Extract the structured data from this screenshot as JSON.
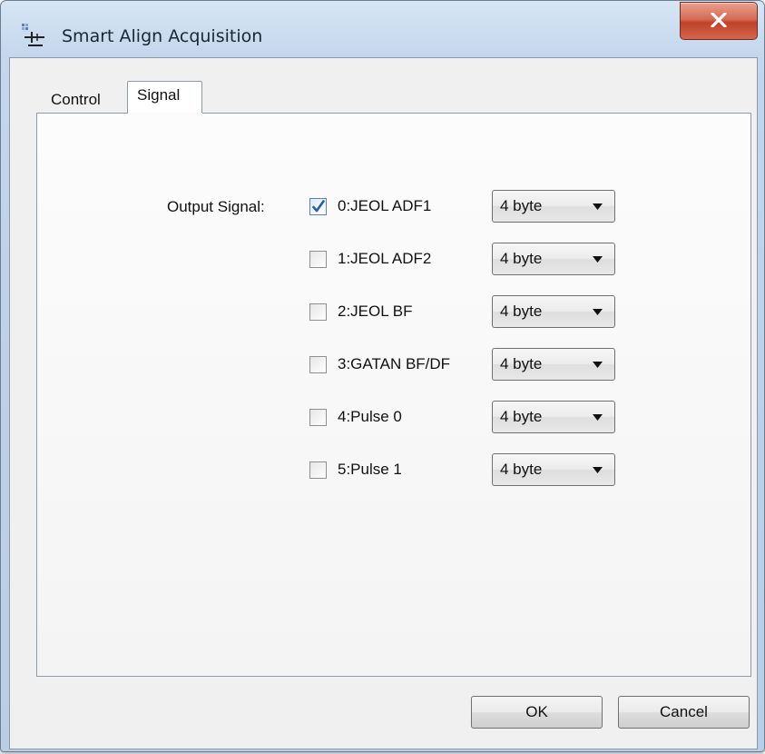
{
  "window": {
    "title": "Smart Align Acquisition"
  },
  "tabs": [
    {
      "label": "Control",
      "active": false
    },
    {
      "label": "Signal",
      "active": true
    }
  ],
  "signal_panel": {
    "output_label": "Output Signal:",
    "signals": [
      {
        "label": "0:JEOL ADF1",
        "checked": true,
        "format": "4 byte"
      },
      {
        "label": "1:JEOL ADF2",
        "checked": false,
        "format": "4 byte"
      },
      {
        "label": "2:JEOL BF",
        "checked": false,
        "format": "4 byte"
      },
      {
        "label": "3:GATAN BF/DF",
        "checked": false,
        "format": "4 byte"
      },
      {
        "label": "4:Pulse 0",
        "checked": false,
        "format": "4 byte"
      },
      {
        "label": "5:Pulse 1",
        "checked": false,
        "format": "4 byte"
      }
    ]
  },
  "buttons": {
    "ok": "OK",
    "cancel": "Cancel"
  },
  "colors": {
    "title_bar": "#c4d7ed",
    "close_button": "#c7503a",
    "checkbox_check": "#2b5da8"
  },
  "icons": {
    "app": "align-acquisition-icon",
    "close": "close-icon",
    "dropdown": "chevron-down-icon",
    "check": "checkmark-icon"
  }
}
